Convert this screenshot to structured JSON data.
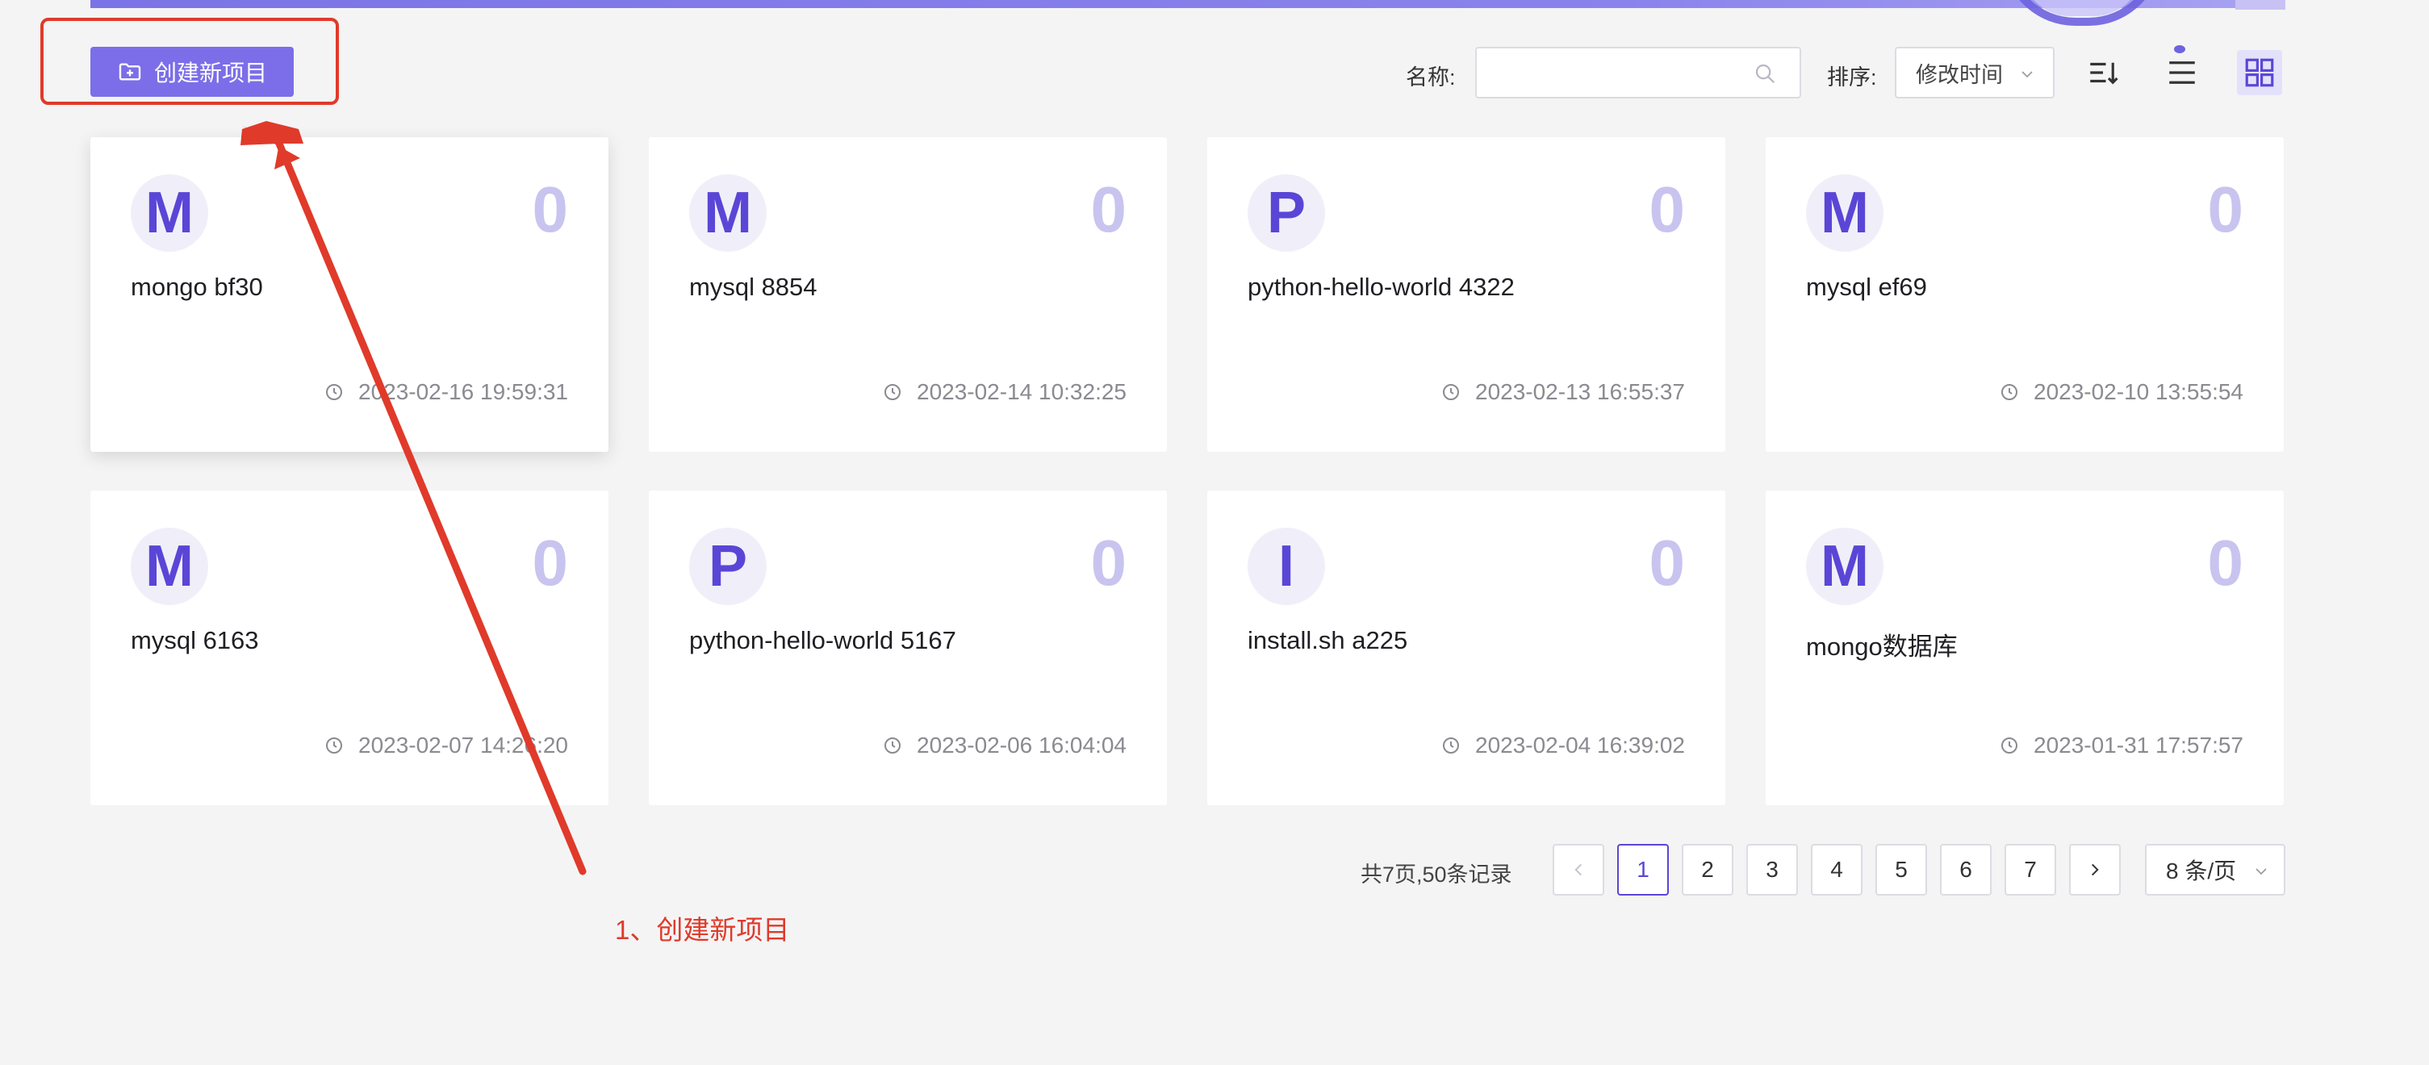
{
  "toolbar": {
    "create_button_label": "创建新项目",
    "name_label": "名称:",
    "search_value": "",
    "search_placeholder": "",
    "sort_label": "排序:",
    "sort_value": "修改时间"
  },
  "cards": [
    {
      "initial": "M",
      "title": "mongo bf30",
      "count": "0",
      "time": "2023-02-16 19:59:31"
    },
    {
      "initial": "M",
      "title": "mysql 8854",
      "count": "0",
      "time": "2023-02-14 10:32:25"
    },
    {
      "initial": "P",
      "title": "python-hello-world 4322",
      "count": "0",
      "time": "2023-02-13 16:55:37"
    },
    {
      "initial": "M",
      "title": "mysql ef69",
      "count": "0",
      "time": "2023-02-10 13:55:54"
    },
    {
      "initial": "M",
      "title": "mysql 6163",
      "count": "0",
      "time": "2023-02-07 14:26:20"
    },
    {
      "initial": "P",
      "title": "python-hello-world 5167",
      "count": "0",
      "time": "2023-02-06 16:04:04"
    },
    {
      "initial": "I",
      "title": "install.sh a225",
      "count": "0",
      "time": "2023-02-04 16:39:02"
    },
    {
      "initial": "M",
      "title": "mongo数据库",
      "count": "0",
      "time": "2023-01-31 17:57:57"
    }
  ],
  "pagination": {
    "summary": "共7页,50条记录",
    "pages": [
      "1",
      "2",
      "3",
      "4",
      "5",
      "6",
      "7"
    ],
    "current_page": "1",
    "page_size": "8 条/页"
  },
  "annotation": {
    "label": "1、创建新项目"
  },
  "colors": {
    "accent": "#5a46d6",
    "button": "#7b6ee8",
    "annotation": "#e03a2a",
    "count": "#c8c4ef"
  }
}
